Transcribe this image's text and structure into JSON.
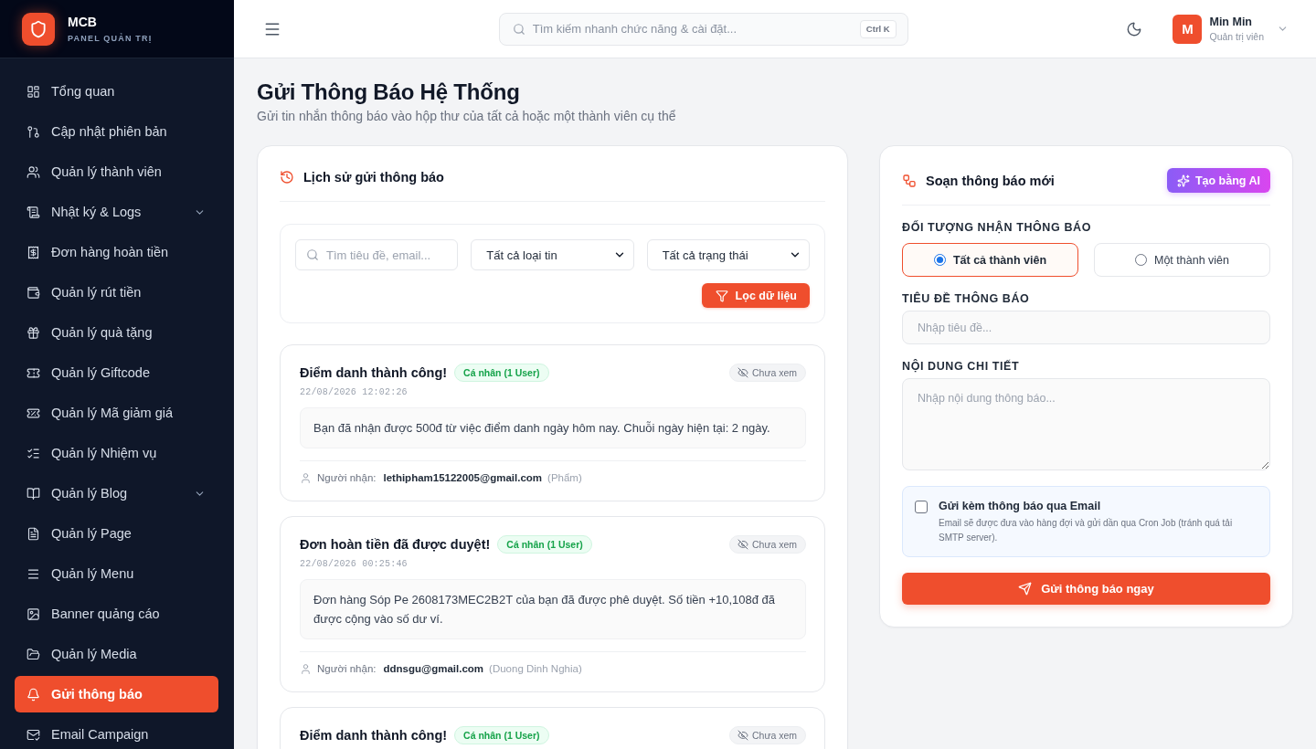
{
  "sidebar": {
    "brand": {
      "name": "MCB",
      "subtitle": "PANEL QUẢN TRỊ"
    },
    "items": [
      {
        "label": "Tổng quan",
        "expandable": false,
        "selected": false
      },
      {
        "label": "Cập nhật phiên bản",
        "expandable": false,
        "selected": false
      },
      {
        "label": "Quản lý thành viên",
        "expandable": false,
        "selected": false
      },
      {
        "label": "Nhật ký & Logs",
        "expandable": true,
        "selected": false
      },
      {
        "label": "Đơn hàng hoàn tiền",
        "expandable": false,
        "selected": false
      },
      {
        "label": "Quản lý rút tiền",
        "expandable": false,
        "selected": false
      },
      {
        "label": "Quản lý quà tặng",
        "expandable": false,
        "selected": false
      },
      {
        "label": "Quản lý Giftcode",
        "expandable": false,
        "selected": false
      },
      {
        "label": "Quản lý Mã giảm giá",
        "expandable": false,
        "selected": false
      },
      {
        "label": "Quản lý Nhiệm vụ",
        "expandable": false,
        "selected": false
      },
      {
        "label": "Quản lý Blog",
        "expandable": true,
        "selected": false
      },
      {
        "label": "Quản lý Page",
        "expandable": false,
        "selected": false
      },
      {
        "label": "Quản lý Menu",
        "expandable": false,
        "selected": false
      },
      {
        "label": "Banner quảng cáo",
        "expandable": false,
        "selected": false
      },
      {
        "label": "Quản lý Media",
        "expandable": false,
        "selected": false
      },
      {
        "label": "Gửi thông báo",
        "expandable": false,
        "selected": true
      },
      {
        "label": "Email Campaign",
        "expandable": false,
        "selected": false
      }
    ]
  },
  "topbar": {
    "search": {
      "placeholder": "Tìm kiếm nhanh chức năng & cài đặt...",
      "shortcut": "Ctrl K"
    },
    "user": {
      "initial": "M",
      "name": "Min Min",
      "role": "Quản trị viên"
    }
  },
  "page": {
    "title": "Gửi Thông Báo Hệ Thống",
    "subtitle": "Gửi tin nhắn thông báo vào hộp thư của tất cả hoặc một thành viên cụ thể"
  },
  "history": {
    "title": "Lịch sử gửi thông báo",
    "filters": {
      "search": {
        "placeholder": "Tìm tiêu đề, email..."
      },
      "type_select": {
        "value": "Tất cả loại tin"
      },
      "status_select": {
        "value": "Tất cả trạng thái"
      },
      "button": "Lọc dữ liệu"
    },
    "notifications": [
      {
        "title": "Điểm danh thành công!",
        "badge": "Cá nhân (1 User)",
        "date": "22/08/2026 12:02:26",
        "read": false,
        "status": "Chưa xem",
        "message": "Bạn đã nhận được 500đ từ việc điểm danh ngày hôm nay. Chuỗi ngày hiện tại: 2 ngày.",
        "recipient_label": "Người nhận:",
        "recipient_email": "lethipham15122005@gmail.com",
        "recipient_name": "(Phẩm)"
      },
      {
        "title": "Đơn hoàn tiền đã được duyệt!",
        "badge": "Cá nhân (1 User)",
        "date": "22/08/2026 00:25:46",
        "read": false,
        "status": "Chưa xem",
        "message": "Đơn hàng Sóp Pe 2608173MEC2B2T của bạn đã được phê duyệt. Số tiền +10,108đ đã được cộng vào số dư ví.",
        "recipient_label": "Người nhận:",
        "recipient_email": "ddnsgu@gmail.com",
        "recipient_name": "(Duong Dinh Nghia)"
      },
      {
        "title": "Điểm danh thành công!",
        "badge": "Cá nhân (1 User)",
        "read": false,
        "status": "Chưa xem"
      }
    ]
  },
  "compose": {
    "title": "Soạn thông báo mới",
    "ai_button": "Tạo bằng AI",
    "audience": {
      "label": "ĐỐI TƯỢNG NHẬN THÔNG BÁO",
      "options": [
        {
          "label": "Tất cả thành viên",
          "selected": true
        },
        {
          "label": "Một thành viên",
          "selected": false
        }
      ]
    },
    "subject": {
      "label": "TIÊU ĐỀ THÔNG BÁO",
      "placeholder": "Nhập tiêu đề..."
    },
    "content": {
      "label": "NỘI DUNG CHI TIẾT",
      "placeholder": "Nhập nội dung thông báo..."
    },
    "email_option": {
      "checked": false,
      "label": "Gửi kèm thông báo qua Email",
      "description": "Email sẽ được đưa vào hàng đợi và gửi dần qua Cron Job (tránh quá tải SMTP server)."
    },
    "send_button": "Gửi thông báo ngay"
  }
}
